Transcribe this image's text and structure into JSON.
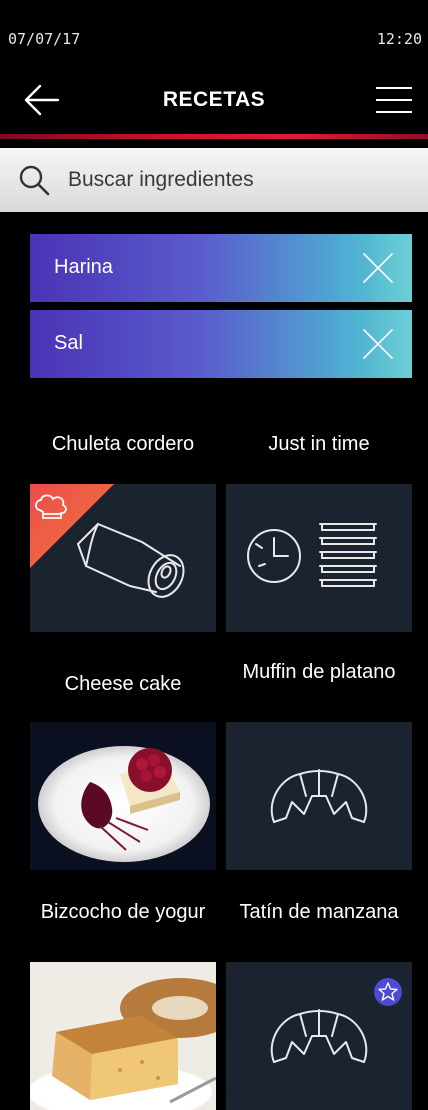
{
  "status": {
    "date": "07/07/17",
    "time": "12:20"
  },
  "header": {
    "title": "RECETAS"
  },
  "search": {
    "placeholder": "Buscar ingredientes"
  },
  "chips": [
    {
      "label": "Harina"
    },
    {
      "label": "Sal"
    }
  ],
  "recipes": [
    {
      "name": "Chuleta cordero",
      "icon": "lamb-roast-icon",
      "badge": "chef-hat-icon",
      "badge_color": "#f0633d"
    },
    {
      "name": "Just in time",
      "icon": "clock-trays-icon"
    },
    {
      "name": "Cheese cake",
      "icon": "cheesecake-photo"
    },
    {
      "name": "Muffin de platano",
      "icon": "croissant-icon"
    },
    {
      "name": "Bizcocho de yogur",
      "icon": "sponge-cake-photo"
    },
    {
      "name": "Tatín de manzana",
      "icon": "croissant-icon",
      "badge": "star-icon",
      "badge_color": "#4d4bd1"
    }
  ],
  "colors": {
    "accent_red": "#d8122d",
    "tile_bg": "#1c2330",
    "chip_gradient_start": "#4a33b6",
    "chip_gradient_end": "#6bd0d4"
  }
}
